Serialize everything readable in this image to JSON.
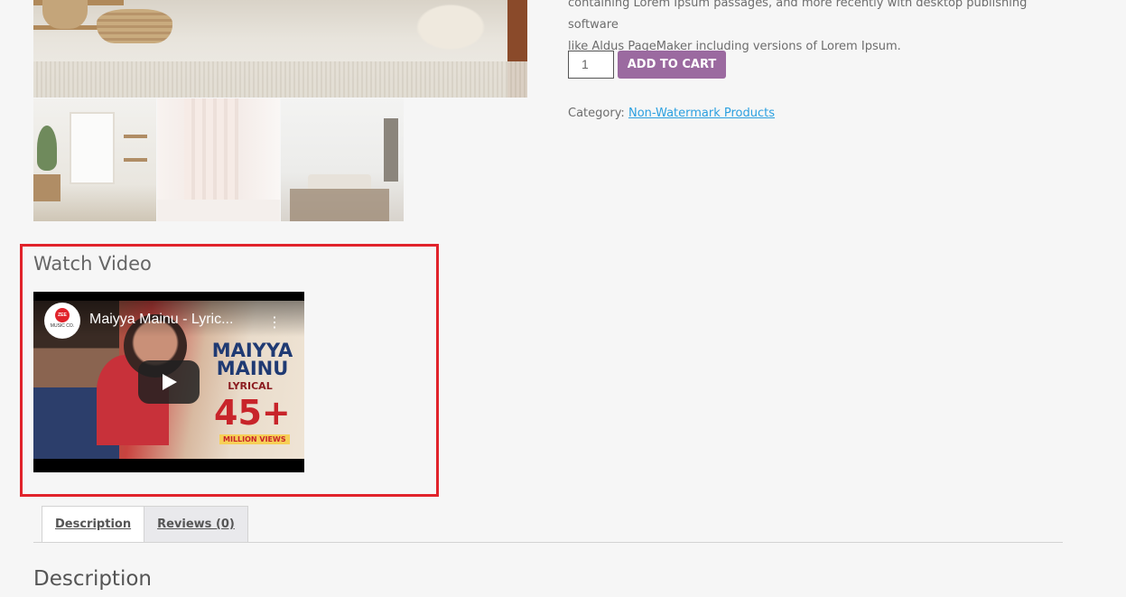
{
  "product": {
    "description_lines": [
      "containing Lorem Ipsum passages, and more recently with desktop publishing software",
      "like Aldus PageMaker including versions of Lorem Ipsum."
    ],
    "quantity": "1",
    "add_to_cart_label": "ADD TO CART",
    "category_label": "Category:",
    "category_link": "Non-Watermark Products"
  },
  "video": {
    "section_title": "Watch Video",
    "title": "Maiyya Mainu - Lyric...",
    "channel_logo": "ZEE",
    "channel_sub": "MUSIC CO.",
    "poster_title": "MAIYYA MAINU",
    "poster_subtitle": "LYRICAL",
    "poster_views": "45+",
    "poster_views_label": "MILLION VIEWS",
    "play_icon": "play-icon",
    "accent_color": "#e1232b"
  },
  "tabs": [
    {
      "label": "Description"
    },
    {
      "label": "Reviews (0)"
    }
  ],
  "section": {
    "title": "Description"
  },
  "colors": {
    "button": "#9b6aa0",
    "link": "#2ba0e0",
    "highlight_border": "#e1232b"
  }
}
